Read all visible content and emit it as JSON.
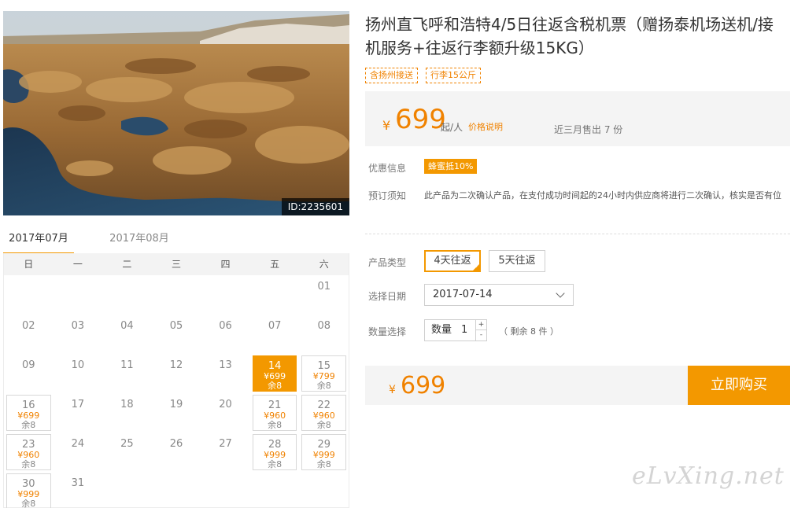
{
  "hero": {
    "image_id": "ID:2235601"
  },
  "calendar": {
    "tabs": [
      "2017年07月",
      "2017年08月"
    ],
    "weekdays": [
      "日",
      "一",
      "二",
      "三",
      "四",
      "五",
      "六"
    ],
    "days": [
      {
        "d": "01"
      },
      {
        "d": "02"
      },
      {
        "d": "03"
      },
      {
        "d": "04"
      },
      {
        "d": "05"
      },
      {
        "d": "06"
      },
      {
        "d": "07"
      },
      {
        "d": "08"
      },
      {
        "d": "09"
      },
      {
        "d": "10"
      },
      {
        "d": "11"
      },
      {
        "d": "12"
      },
      {
        "d": "13"
      },
      {
        "d": "14",
        "price": "¥699",
        "stock": "余8",
        "selected": true
      },
      {
        "d": "15",
        "price": "¥799",
        "stock": "余8"
      },
      {
        "d": "16",
        "price": "¥699",
        "stock": "余8"
      },
      {
        "d": "17"
      },
      {
        "d": "18"
      },
      {
        "d": "19"
      },
      {
        "d": "20"
      },
      {
        "d": "21",
        "price": "¥960",
        "stock": "余8"
      },
      {
        "d": "22",
        "price": "¥960",
        "stock": "余8"
      },
      {
        "d": "23",
        "price": "¥960",
        "stock": "余8"
      },
      {
        "d": "24"
      },
      {
        "d": "25"
      },
      {
        "d": "26"
      },
      {
        "d": "27"
      },
      {
        "d": "28",
        "price": "¥999",
        "stock": "余8"
      },
      {
        "d": "29",
        "price": "¥999",
        "stock": "余8"
      },
      {
        "d": "30",
        "price": "¥999",
        "stock": "余8"
      },
      {
        "d": "31"
      }
    ]
  },
  "product": {
    "title": "扬州直飞呼和浩特4/5日往返含税机票（赠扬泰机场送机/接机服务+往返行李额升级15KG）",
    "tags": [
      "含扬州接送",
      "行李15公斤"
    ]
  },
  "price": {
    "currency": "¥",
    "amount": "699",
    "per": "起/人",
    "explain": "价格说明",
    "sold": "近三月售出 7 份"
  },
  "info": {
    "promo_label": "优惠信息",
    "promo_badge": "蜂蜜抵10%",
    "notice_label": "预订须知",
    "notice_text": "此产品为二次确认产品，在支付成功时间起的24小时内供应商将进行二次确认，核实是否有位"
  },
  "options": {
    "type_label": "产品类型",
    "types": [
      "4天往返",
      "5天往返"
    ],
    "date_label": "选择日期",
    "date_value": "2017-07-14",
    "qty_label": "数量选择",
    "qty_prefix": "数量",
    "qty_value": "1",
    "plus": "+",
    "minus": "-",
    "remain": "（ 剩余 8 件 ）"
  },
  "buy": {
    "currency": "¥",
    "total": "699",
    "button": "立即购买"
  },
  "watermark": "eLvXing.net",
  "colors": {
    "accent": "#f39800",
    "price": "#f08200"
  }
}
